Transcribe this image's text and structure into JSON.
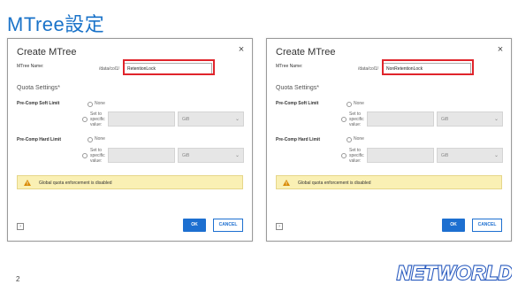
{
  "slide": {
    "title": "MTree設定",
    "page_number": "2",
    "logo_text": "NETWORLD"
  },
  "dialogs": [
    {
      "title": "Create MTree",
      "close_icon": "×",
      "mtree_name_label": "MTree Name:",
      "path_prefix": "/data/col1/",
      "mtree_name_value": "RetentionLock",
      "quota_section": "Quota Settings*",
      "soft_limit_label": "Pre-Comp Soft Limit",
      "hard_limit_label": "Pre-Comp Hard Limit",
      "none_label": "None",
      "specific_label": "Set to specific value:",
      "unit_value": "GiB",
      "warning_text": "Global quota enforcement is disabled",
      "help_icon": "?",
      "ok_label": "OK",
      "cancel_label": "CANCEL"
    },
    {
      "title": "Create MTree",
      "close_icon": "×",
      "mtree_name_label": "MTree Name:",
      "path_prefix": "/data/col1/",
      "mtree_name_value": "NonRetentionLock",
      "quota_section": "Quota Settings*",
      "soft_limit_label": "Pre-Comp Soft Limit",
      "hard_limit_label": "Pre-Comp Hard Limit",
      "none_label": "None",
      "specific_label": "Set to specific value:",
      "unit_value": "GiB",
      "warning_text": "Global quota enforcement is disabled",
      "help_icon": "?",
      "ok_label": "OK",
      "cancel_label": "CANCEL"
    }
  ],
  "colors": {
    "title_blue": "#1a73c9",
    "highlight_red": "#e0242b",
    "ok_blue": "#1d6fd0",
    "warning_bg": "#faf0b4"
  }
}
